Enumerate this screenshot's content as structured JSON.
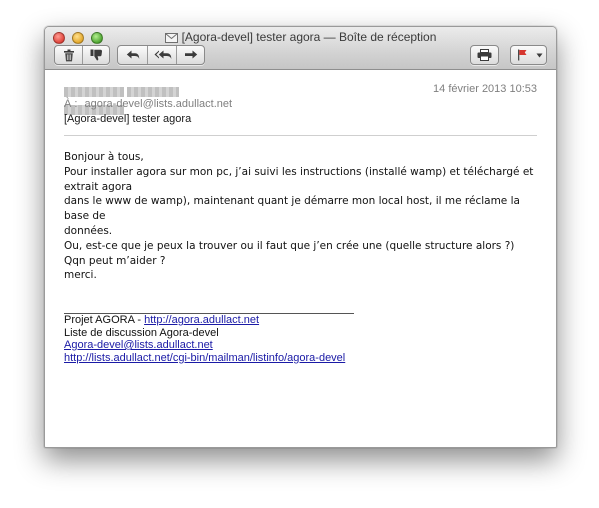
{
  "window": {
    "title": "[Agora-devel] tester agora — Boîte de réception"
  },
  "toolbar": {
    "delete_icon": "trash-icon",
    "junk_icon": "thumbs-down-icon",
    "reply_icon": "reply-icon",
    "reply_all_icon": "reply-all-icon",
    "forward_icon": "forward-icon",
    "print_icon": "printer-icon",
    "flag_icon": "flag-icon",
    "flag_color": "#d6362f"
  },
  "message": {
    "date": "14 février 2013 10:53",
    "to_label": "À :",
    "to_address": "agora-devel@lists.adullact.net",
    "subject": "[Agora-devel] tester agora",
    "body_lines": [
      "Bonjour à tous,",
      "Pour installer agora sur mon pc, j’ai suivi les instructions (installé wamp) et téléchargé et extrait agora",
      "dans le www de wamp), maintenant quant je démarre mon local host, il me réclame la base de",
      "données.",
      "Ou, est-ce que je peux la trouver ou il faut que j’en crée une (quelle structure alors ?)",
      "Qqn peut m’aider ?",
      "merci."
    ],
    "footer": {
      "project_prefix": "Projet AGORA - ",
      "project_link": "http://agora.adullact.net",
      "list_name": "Liste de discussion Agora-devel",
      "list_email": "Agora-devel@lists.adullact.net",
      "list_url": "http://lists.adullact.net/cgi-bin/mailman/listinfo/agora-devel"
    }
  }
}
